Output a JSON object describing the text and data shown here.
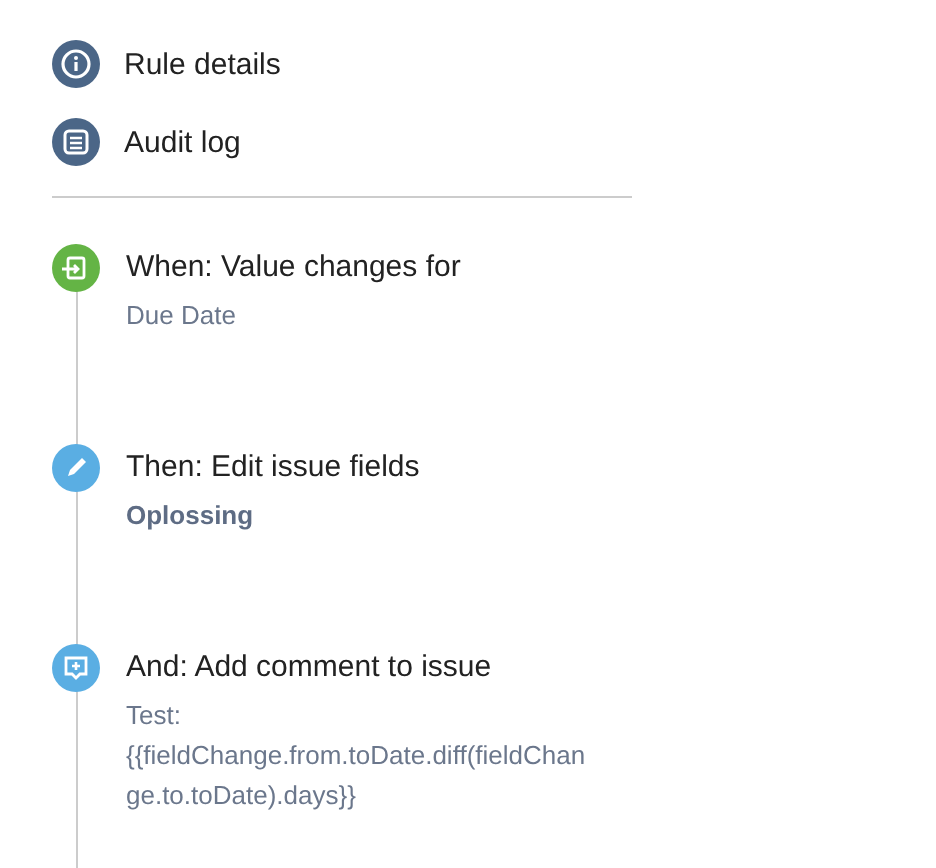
{
  "nav_items": [
    {
      "label": "Rule details",
      "kind": "info"
    },
    {
      "label": "Audit log",
      "kind": "log"
    }
  ],
  "steps": [
    {
      "kind": "trigger",
      "title": "When: Value changes for",
      "detail": "Due Date",
      "bold": false
    },
    {
      "kind": "edit",
      "title": "Then: Edit issue fields",
      "detail": "Oplossing",
      "bold": true
    },
    {
      "kind": "comment",
      "title": "And: Add comment to issue",
      "detail": "Test:\n{{fieldChange.from.toDate.diff(fieldChan\nge.to.toDate).days}}",
      "bold": false
    }
  ]
}
